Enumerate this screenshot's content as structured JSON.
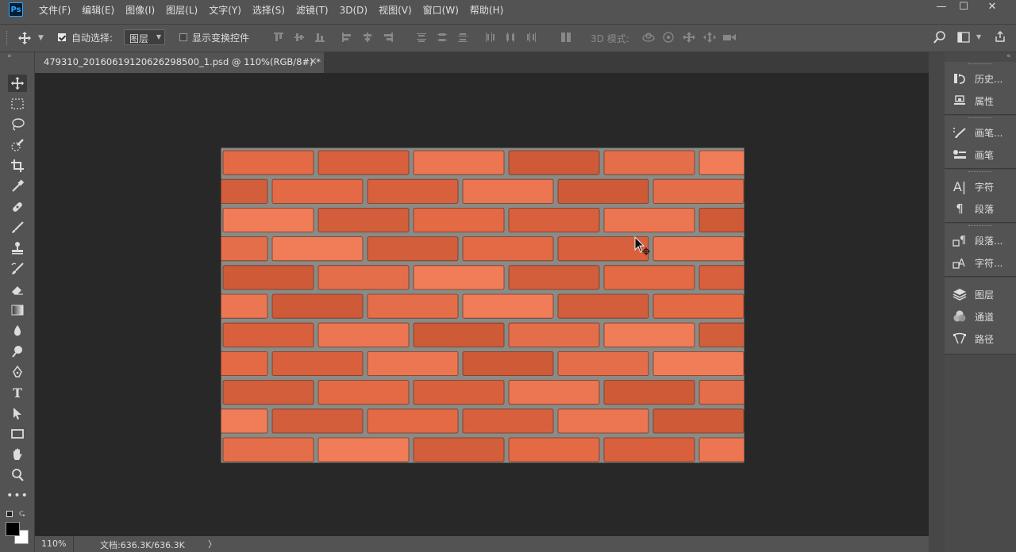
{
  "menubar": {
    "logo": "Ps",
    "items": [
      "文件(F)",
      "编辑(E)",
      "图像(I)",
      "图层(L)",
      "文字(Y)",
      "选择(S)",
      "滤镜(T)",
      "3D(D)",
      "视图(V)",
      "窗口(W)",
      "帮助(H)"
    ],
    "window_controls": [
      "—",
      "☐",
      "✕"
    ]
  },
  "options": {
    "auto_select_label": "自动选择:",
    "auto_select_checked": true,
    "auto_select_value": "图层",
    "show_transform_label": "显示变换控件",
    "show_transform_checked": false,
    "mode_3d_label": "3D 模式:"
  },
  "document": {
    "tab_title": "479310_20160619120626298500_1.psd @ 110%(RGB/8#) *",
    "close_glyph": "×",
    "brick_color": "#e36a45",
    "mortar_color": "#8c8a85"
  },
  "status": {
    "zoom": "110%",
    "doc_info": "文档:636.3K/636.3K",
    "arrow": "〉"
  },
  "panels": {
    "groups": [
      {
        "items": [
          {
            "icon": "history-icon",
            "label": "历史..."
          },
          {
            "icon": "properties-icon",
            "label": "属性"
          }
        ]
      },
      {
        "items": [
          {
            "icon": "brush-settings-icon",
            "label": "画笔..."
          },
          {
            "icon": "brush-icon",
            "label": "画笔"
          }
        ]
      },
      {
        "items": [
          {
            "icon": "character-icon",
            "label": "字符"
          },
          {
            "icon": "paragraph-icon",
            "label": "段落"
          }
        ]
      },
      {
        "items": [
          {
            "icon": "paragraph-styles-icon",
            "label": "段落..."
          },
          {
            "icon": "character-styles-icon",
            "label": "字符..."
          }
        ]
      },
      {
        "items": [
          {
            "icon": "layers-icon",
            "label": "图层"
          },
          {
            "icon": "channels-icon",
            "label": "通道"
          },
          {
            "icon": "paths-icon",
            "label": "路径"
          }
        ]
      }
    ]
  },
  "tools": [
    "move-tool-icon",
    "marquee-tool-icon",
    "lasso-tool-icon",
    "quick-select-tool-icon",
    "crop-tool-icon",
    "eyedropper-tool-icon",
    "healing-brush-tool-icon",
    "brush-tool-icon",
    "clone-stamp-tool-icon",
    "history-brush-tool-icon",
    "eraser-tool-icon",
    "gradient-tool-icon",
    "blur-tool-icon",
    "dodge-tool-icon",
    "pen-tool-icon",
    "type-tool-icon",
    "path-select-tool-icon",
    "rectangle-tool-icon",
    "hand-tool-icon",
    "zoom-tool-icon",
    "more-tools-icon"
  ],
  "colors": {
    "foreground": "#000000",
    "background": "#ffffff"
  }
}
